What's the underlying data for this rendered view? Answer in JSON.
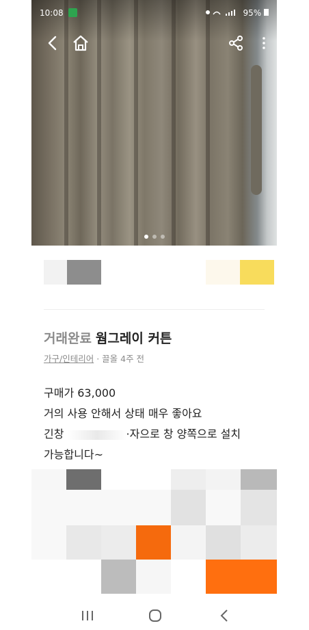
{
  "status_bar": {
    "time": "10:08",
    "right": "95%"
  },
  "photo": {
    "page_indicator": {
      "count": 3,
      "active": 0
    }
  },
  "listing": {
    "status_label": "거래완료",
    "title": "웜그레이 커튼",
    "category": "가구/인테리어",
    "location_time": "· 끌올 4주 전",
    "description_lines": [
      "구매가 63,000",
      "거의 사용 안해서 상태 매우 좋아요",
      "긴창",
      "·자으로 창 양쪽으로 설치",
      "가능합니다~"
    ]
  },
  "icons": {
    "back": "chevron-left-icon",
    "home": "home-icon",
    "share": "share-icon",
    "more": "more-vertical-icon",
    "recent": "recent-apps-icon",
    "home_nav": "home-circle-icon",
    "back_nav": "back-nav-icon"
  },
  "colors": {
    "accent": "#ff6f0f",
    "status_text": "#8a8a8a"
  }
}
